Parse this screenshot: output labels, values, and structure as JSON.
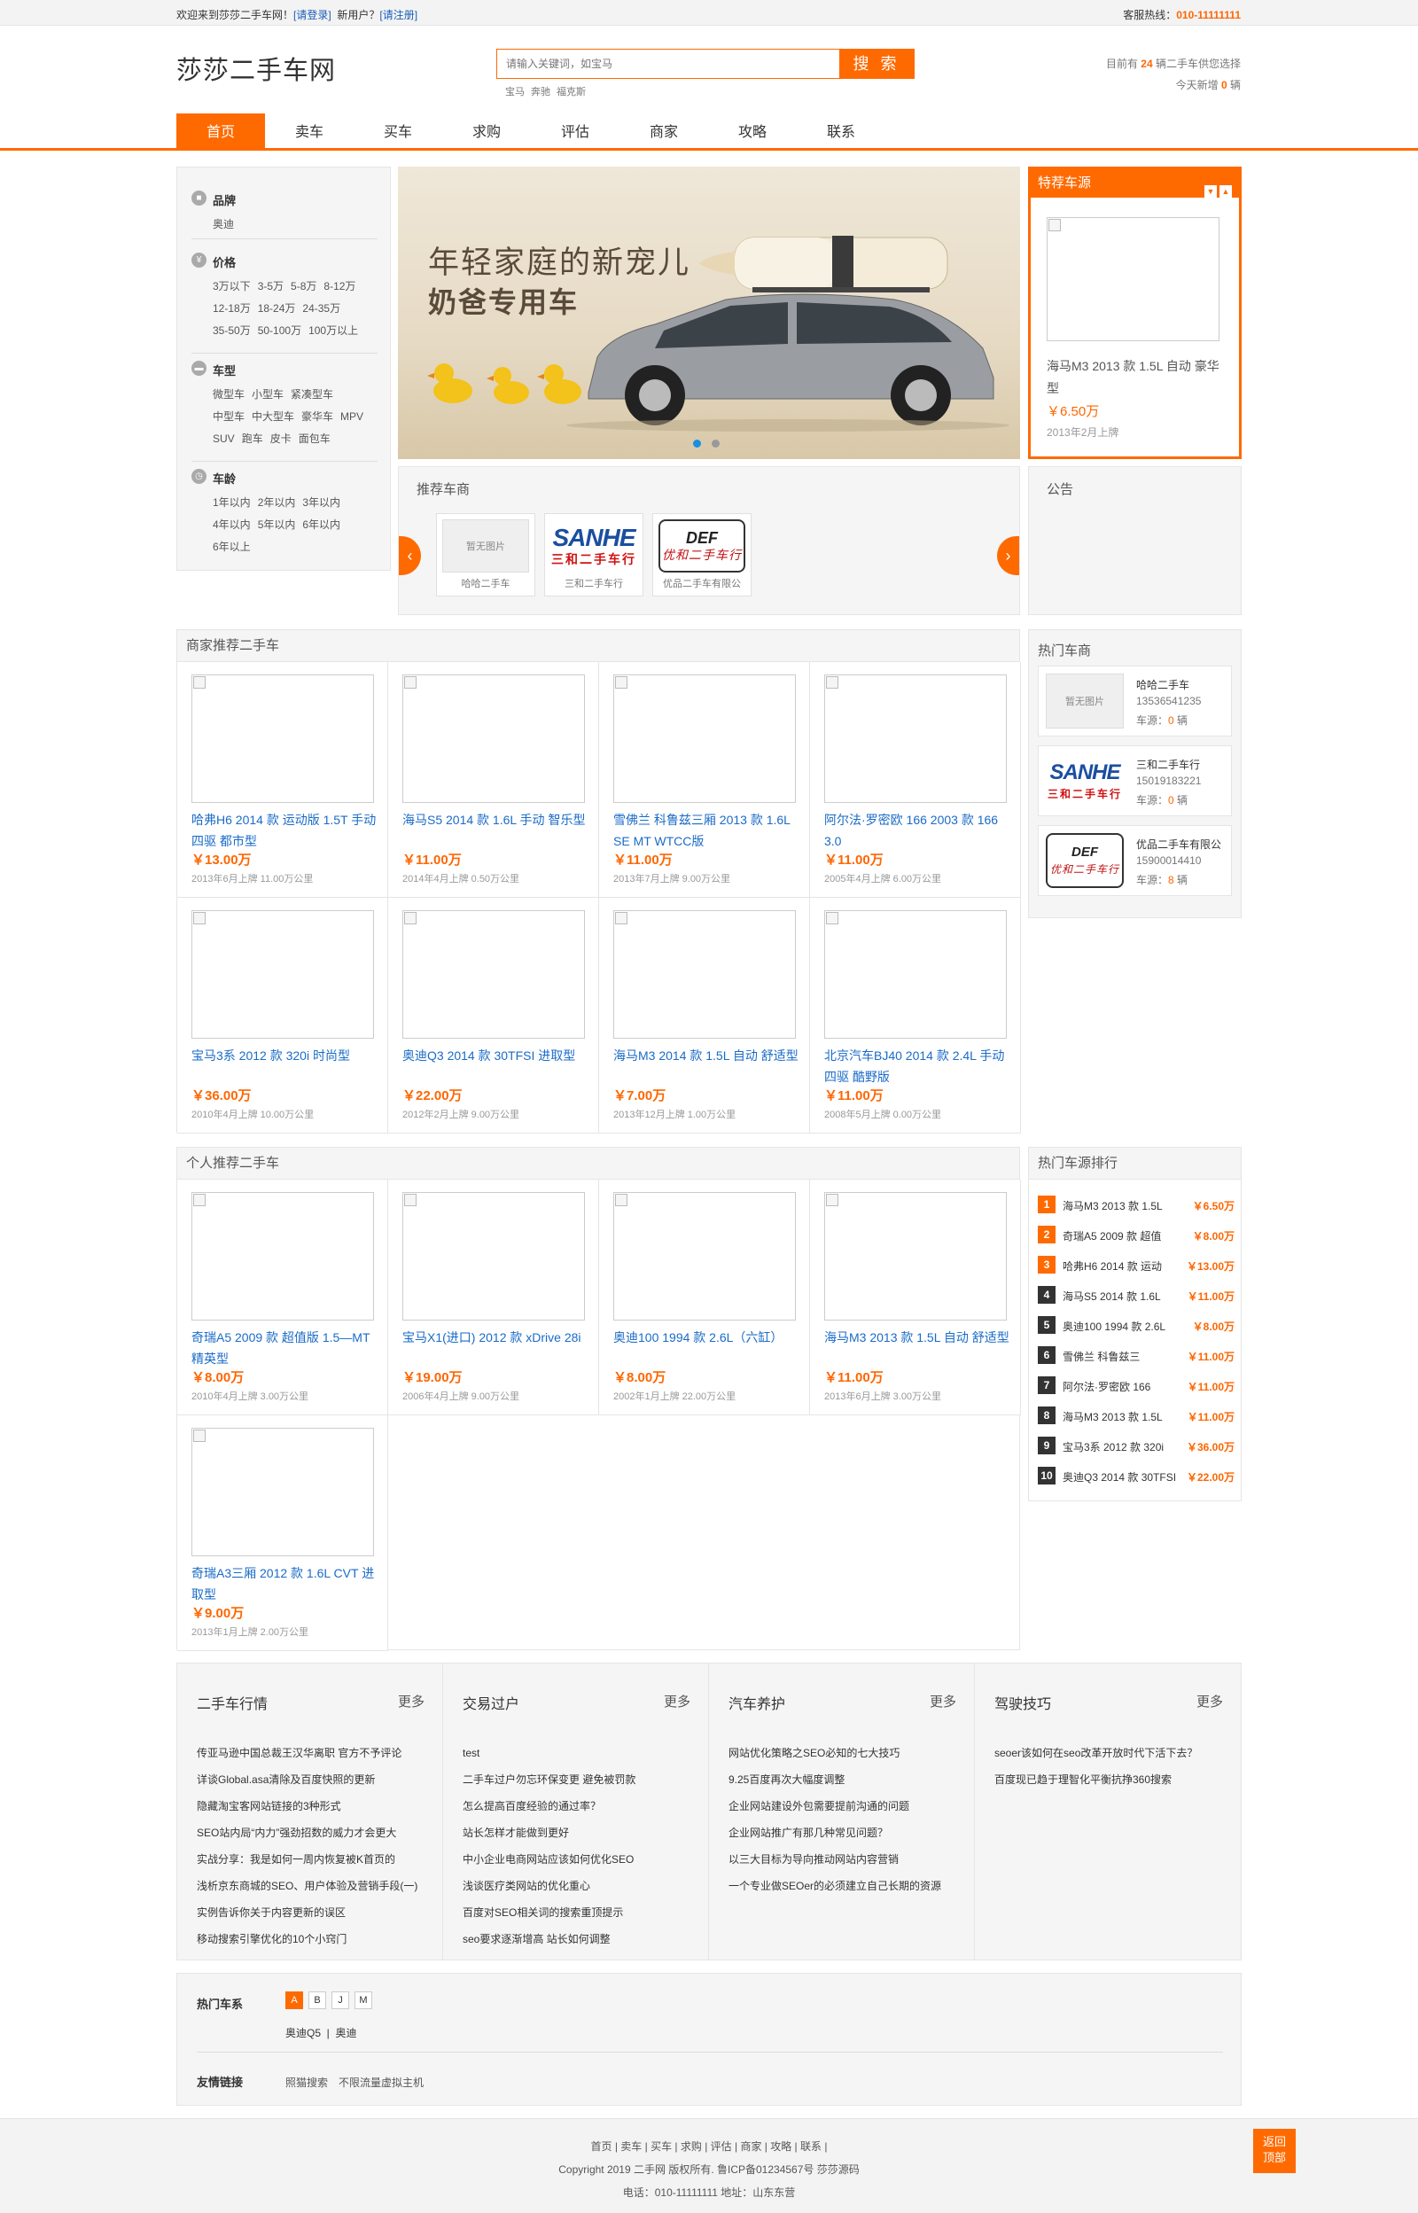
{
  "topbar": {
    "welcome": "欢迎来到莎莎二手车网！",
    "login": "[请登录]",
    "new_user": "新用户？",
    "register": "[请注册]",
    "hotline_label": "客服热线：",
    "hotline": "010-11111111"
  },
  "header": {
    "logo": "莎莎二手车网",
    "search_placeholder": "请输入关键词，如宝马",
    "search_button": "搜 索",
    "hot_words": [
      "宝马",
      "奔驰",
      "福克斯"
    ],
    "stat1_a": "目前有 ",
    "stat1_num": "24",
    "stat1_b": " 辆二手车供您选择",
    "stat2_a": "今天新增 ",
    "stat2_num": "0",
    "stat2_b": " 辆"
  },
  "nav": [
    "首页",
    "卖车",
    "买车",
    "求购",
    "评估",
    "商家",
    "攻略",
    "联系"
  ],
  "filter": {
    "brand": {
      "title": "品牌",
      "items": [
        "奥迪"
      ]
    },
    "price": {
      "title": "价格",
      "items": [
        "3万以下",
        "3-5万",
        "5-8万",
        "8-12万",
        "12-18万",
        "18-24万",
        "24-35万",
        "35-50万",
        "50-100万",
        "100万以上"
      ]
    },
    "type": {
      "title": "车型",
      "items": [
        "微型车",
        "小型车",
        "紧凑型车",
        "中型车",
        "中大型车",
        "豪华车",
        "MPV",
        "SUV",
        "跑车",
        "皮卡",
        "面包车"
      ]
    },
    "age": {
      "title": "车龄",
      "items": [
        "1年以内",
        "2年以内",
        "3年以内",
        "4年以内",
        "5年以内",
        "6年以内",
        "6年以上"
      ]
    }
  },
  "banner": {
    "line1": "年轻家庭的新宠儿",
    "line2": "奶爸专用车"
  },
  "special": {
    "title": "特荐车源",
    "name": "海马M3 2013 款 1.5L 自动 豪华型",
    "price": "￥6.50万",
    "date": "2013年2月上牌"
  },
  "dealers": {
    "title": "推荐车商",
    "items": [
      {
        "caption": "哈哈二手车",
        "noimg": "暂无图片"
      },
      {
        "caption": "三和二手车行",
        "logo_a": "SANHE",
        "logo_b": "三和二手车行"
      },
      {
        "caption": "优品二手车有限公",
        "logo_a": "DEF",
        "logo_b": "优和二手车行"
      }
    ]
  },
  "notice": {
    "title": "公告"
  },
  "merchant": {
    "title": "商家推荐二手车",
    "cars": [
      {
        "name": "哈弗H6 2014 款 运动版 1.5T 手动 四驱 都市型",
        "price": "￥13.00万",
        "meta": "2013年6月上牌  11.00万公里"
      },
      {
        "name": "海马S5 2014 款 1.6L 手动 智乐型",
        "price": "￥11.00万",
        "meta": "2014年4月上牌  0.50万公里"
      },
      {
        "name": "雪佛兰 科鲁兹三厢 2013 款 1.6L SE MT WTCC版",
        "price": "￥11.00万",
        "meta": "2013年7月上牌  9.00万公里"
      },
      {
        "name": "阿尔法·罗密欧 166 2003 款 166 3.0",
        "price": "￥11.00万",
        "meta": "2005年4月上牌  6.00万公里"
      },
      {
        "name": "宝马3系 2012 款 320i 时尚型",
        "price": "￥36.00万",
        "meta": "2010年4月上牌  10.00万公里"
      },
      {
        "name": "奥迪Q3 2014 款 30TFSI 进取型",
        "price": "￥22.00万",
        "meta": "2012年2月上牌  9.00万公里"
      },
      {
        "name": "海马M3 2014 款 1.5L 自动 舒适型",
        "price": "￥7.00万",
        "meta": "2013年12月上牌  1.00万公里"
      },
      {
        "name": "北京汽车BJ40 2014 款 2.4L 手动 四驱 酷野版",
        "price": "￥11.00万",
        "meta": "2008年5月上牌  0.00万公里"
      }
    ]
  },
  "personal": {
    "title": "个人推荐二手车",
    "cars": [
      {
        "name": "奇瑞A5 2009 款 超值版 1.5—MT 精英型",
        "price": "￥8.00万",
        "meta": "2010年4月上牌  3.00万公里"
      },
      {
        "name": "宝马X1(进口) 2012 款 xDrive 28i",
        "price": "￥19.00万",
        "meta": "2006年4月上牌  9.00万公里"
      },
      {
        "name": "奥迪100 1994 款 2.6L（六缸）",
        "price": "￥8.00万",
        "meta": "2002年1月上牌  22.00万公里"
      },
      {
        "name": "海马M3 2013 款 1.5L 自动 舒适型",
        "price": "￥11.00万",
        "meta": "2013年6月上牌  3.00万公里"
      },
      {
        "name": "奇瑞A3三厢 2012 款 1.6L CVT 进取型",
        "price": "￥9.00万",
        "meta": "2013年1月上牌  2.00万公里"
      }
    ]
  },
  "hot_dealers": {
    "title": "热门车商",
    "items": [
      {
        "name": "哈哈二手车",
        "phone": "13536541235",
        "count_label": "车源：",
        "count": "0",
        "unit": " 辆",
        "noimg": "暂无图片"
      },
      {
        "name": "三和二手车行",
        "phone": "15019183221",
        "count_label": "车源：",
        "count": "0",
        "unit": " 辆"
      },
      {
        "name": "优品二手车有限公",
        "phone": "15900014410",
        "count_label": "车源：",
        "count": "8",
        "unit": " 辆"
      }
    ]
  },
  "ranking": {
    "title": "热门车源排行",
    "items": [
      {
        "n": "1",
        "name": "海马M3 2013 款 1.5L",
        "price": "￥6.50万"
      },
      {
        "n": "2",
        "name": "奇瑞A5 2009 款 超值",
        "price": "￥8.00万"
      },
      {
        "n": "3",
        "name": "哈弗H6 2014 款 运动",
        "price": "￥13.00万"
      },
      {
        "n": "4",
        "name": "海马S5 2014 款 1.6L",
        "price": "￥11.00万"
      },
      {
        "n": "5",
        "name": "奥迪100 1994 款 2.6L",
        "price": "￥8.00万"
      },
      {
        "n": "6",
        "name": "雪佛兰 科鲁兹三",
        "price": "￥11.00万"
      },
      {
        "n": "7",
        "name": "阿尔法·罗密欧 166",
        "price": "￥11.00万"
      },
      {
        "n": "8",
        "name": "海马M3 2013 款 1.5L",
        "price": "￥11.00万"
      },
      {
        "n": "9",
        "name": "宝马3系 2012 款 320i",
        "price": "￥36.00万"
      },
      {
        "n": "10",
        "name": "奥迪Q3 2014 款 30TFSI",
        "price": "￥22.00万"
      }
    ]
  },
  "news": [
    {
      "title": "二手车行情",
      "more": "更多",
      "items": [
        "传亚马逊中国总裁王汉华离职 官方不予评论",
        "详谈Global.asa清除及百度快照的更新",
        "隐藏淘宝客网站链接的3种形式",
        "SEO站内局“内力”强劲招数的威力才会更大",
        "实战分享：我是如何一周内恢复被K首页的",
        "浅析京东商城的SEO、用户体验及营销手段(一)",
        "实例告诉你关于内容更新的误区",
        "移动搜索引擎优化的10个小窍门"
      ]
    },
    {
      "title": "交易过户",
      "more": "更多",
      "items": [
        "test",
        "二手车过户勿忘环保变更 避免被罚款",
        "怎么提高百度经验的通过率？",
        "站长怎样才能做到更好",
        "中小企业电商网站应该如何优化SEO",
        "浅谈医疗类网站的优化重心",
        "百度对SEO相关词的搜索重顶提示",
        "seo要求逐渐增高 站长如何调整"
      ]
    },
    {
      "title": "汽车养护",
      "more": "更多",
      "items": [
        "网站优化策略之SEO必知的七大技巧",
        "9.25百度再次大幅度调整",
        "企业网站建设外包需要提前沟通的问题",
        "企业网站推广有那几种常见问题？",
        "以三大目标为导向推动网站内容营销",
        "一个专业做SEOer的必须建立自己长期的资源"
      ]
    },
    {
      "title": "驾驶技巧",
      "more": "更多",
      "items": [
        "seoer该如何在seo改革开放时代下活下去？",
        "百度现已趋于理智化平衡抗挣360搜索"
      ]
    }
  ],
  "links": {
    "hot_models_label": "热门车系",
    "letters": [
      "A",
      "B",
      "J",
      "M"
    ],
    "models": [
      "奥迪Q5",
      "奥迪"
    ],
    "friend_label": "友情链接",
    "friend": [
      "照猫搜索",
      "不限流量虚拟主机"
    ]
  },
  "footer": {
    "links": "首页 | 卖车 | 买车 | 求购 | 评估 | 商家 | 攻略 | 联系 |",
    "copyright": "Copyright 2019 二手网 版权所有. 鲁ICP备01234567号 莎莎源码",
    "contact": "电话：010-11111111 地址：山东东营"
  },
  "backtop": {
    "l1": "返回",
    "l2": "顶部"
  }
}
